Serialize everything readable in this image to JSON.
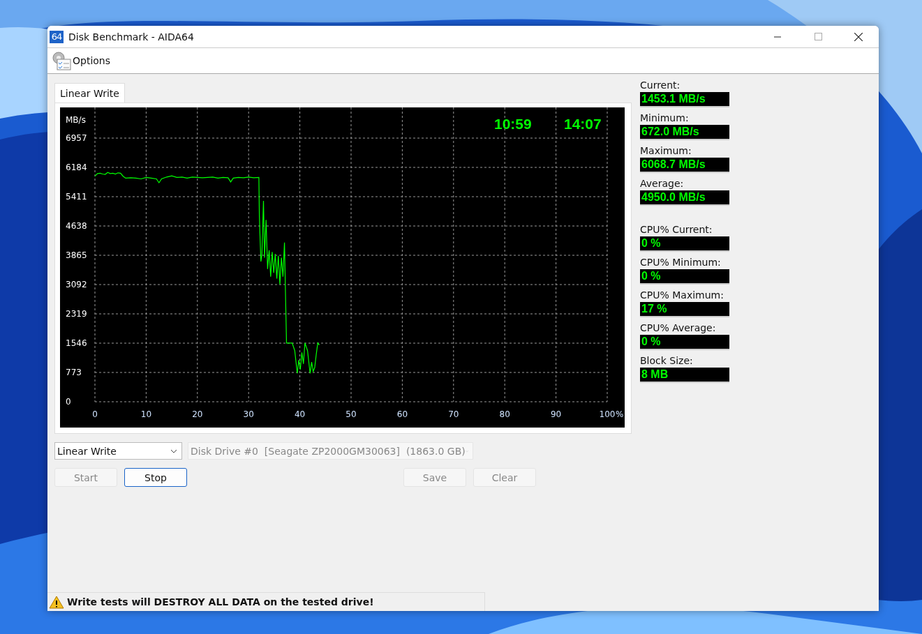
{
  "window": {
    "title": "Disk Benchmark - AIDA64",
    "app_icon": "64"
  },
  "menu": [
    {
      "label": "Options"
    }
  ],
  "tabs": [
    {
      "label": "Linear Write",
      "selected": true
    }
  ],
  "chart": {
    "timers": [
      "10:59",
      "14:07"
    ],
    "chart_data": {
      "type": "line",
      "xlabel": "%",
      "ylabel": "MB/s",
      "xlim": [
        0,
        100
      ],
      "ylim": [
        0,
        7767
      ],
      "grid": true,
      "xticks": [
        0,
        10,
        20,
        30,
        40,
        50,
        60,
        70,
        80,
        90,
        100
      ],
      "yticks": [
        0,
        773,
        1546,
        2319,
        3092,
        3865,
        4638,
        5411,
        6184,
        6957
      ],
      "x": [
        0,
        0.5,
        1,
        1.5,
        2,
        2.5,
        3,
        3.5,
        4,
        4.5,
        5,
        5.5,
        6,
        7,
        8,
        9,
        10,
        11,
        12,
        12.5,
        13,
        14,
        15,
        16,
        17,
        18,
        19,
        20,
        21,
        22,
        23,
        24,
        25,
        26,
        26.5,
        27,
        28,
        29,
        30,
        31,
        32,
        32.1,
        32.4,
        32.6,
        32.9,
        33.1,
        33.4,
        33.7,
        34,
        34.3,
        34.6,
        34.9,
        35.2,
        35.5,
        35.8,
        36.1,
        36.4,
        36.7,
        37,
        37.2,
        37.4,
        37.6,
        38.5,
        39,
        39.5,
        39.8,
        40.1,
        40.4,
        40.7,
        41,
        41.5,
        42,
        42.3,
        42.6,
        42.9,
        43.2,
        43.5,
        43.8
      ],
      "series": [
        {
          "color": "#00ff00",
          "values": [
            5950,
            6020,
            6030,
            6010,
            6000,
            6050,
            6020,
            6030,
            6010,
            6040,
            6030,
            5950,
            5900,
            5910,
            5900,
            5880,
            5920,
            5900,
            5880,
            5780,
            5880,
            5930,
            5960,
            5920,
            5930,
            5900,
            5930,
            5920,
            5910,
            5920,
            5930,
            5900,
            5920,
            5910,
            5800,
            5900,
            5920,
            5910,
            5930,
            5910,
            5920,
            4900,
            3700,
            3900,
            5300,
            3800,
            4800,
            3500,
            4000,
            3300,
            3950,
            3400,
            3900,
            3250,
            3850,
            3100,
            3800,
            3300,
            4200,
            2900,
            1550,
            1550,
            1550,
            1350,
            750,
            1100,
            850,
            1300,
            1000,
            1550,
            1350,
            750,
            1050,
            800,
            900,
            1250,
            1550,
            1500
          ]
        }
      ]
    }
  },
  "stats": [
    {
      "label": "Current:",
      "value": "1453.1 MB/s"
    },
    {
      "label": "Minimum:",
      "value": "672.0 MB/s"
    },
    {
      "label": "Maximum:",
      "value": "6068.7 MB/s"
    },
    {
      "label": "Average:",
      "value": "4950.0 MB/s"
    },
    {
      "label": "CPU% Current:",
      "value": "0 %"
    },
    {
      "label": "CPU% Minimum:",
      "value": "0 %"
    },
    {
      "label": "CPU% Maximum:",
      "value": "17 %"
    },
    {
      "label": "CPU% Average:",
      "value": "0 %"
    },
    {
      "label": "Block Size:",
      "value": "8 MB"
    }
  ],
  "test_select": {
    "value": "Linear Write",
    "disabled": false
  },
  "drive_select": {
    "value": "Disk Drive #0  [Seagate ZP2000GM30063]  (1863.0 GB)",
    "disabled": true
  },
  "buttons": [
    {
      "label": "Start",
      "disabled": true,
      "focused": false
    },
    {
      "label": "Stop",
      "disabled": false,
      "focused": true
    },
    {
      "label": "Save",
      "disabled": true,
      "focused": false
    },
    {
      "label": "Clear",
      "disabled": true,
      "focused": false
    }
  ],
  "status_bar": {
    "text": "Write tests will DESTROY ALL DATA on the tested drive!"
  }
}
